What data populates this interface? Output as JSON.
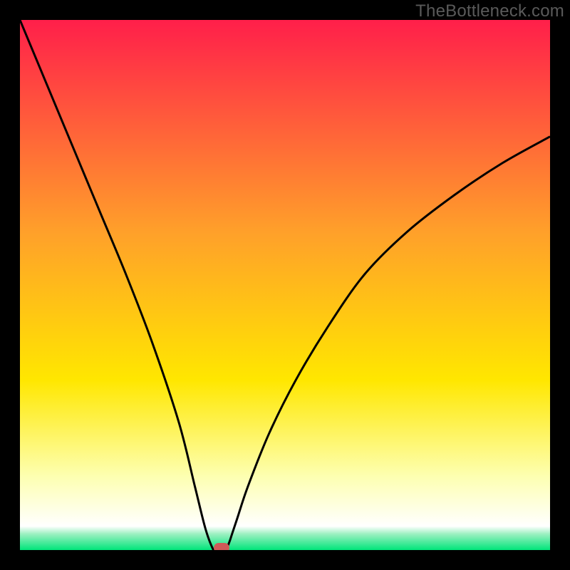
{
  "watermark": "TheBottleneck.com",
  "colors": {
    "frame": "#000000",
    "gradient_top": "#ff1f4a",
    "gradient_mid1": "#ffa02a",
    "gradient_mid2": "#ffe700",
    "gradient_mid3": "#fdffb0",
    "gradient_bottom": "#00e57a",
    "curve": "#000000",
    "marker": "#d05a58"
  },
  "chart_data": {
    "type": "line",
    "title": "",
    "xlabel": "",
    "ylabel": "",
    "xlim": [
      0,
      100
    ],
    "ylim": [
      0,
      100
    ],
    "series": [
      {
        "name": "bottleneck-curve",
        "x": [
          0,
          5,
          10,
          15,
          20,
          25,
          30,
          33,
          35,
          36.5,
          37,
          38,
          39,
          39.5,
          40,
          41,
          43,
          47,
          52,
          58,
          65,
          73,
          82,
          91,
          100
        ],
        "y": [
          100,
          88,
          76,
          64,
          52,
          39,
          24,
          12,
          4,
          0,
          0,
          0,
          0.5,
          1.5,
          3,
          6,
          12,
          22,
          32,
          42,
          52,
          60,
          67,
          73,
          78
        ]
      }
    ],
    "marker": {
      "x": 38,
      "y": 0,
      "color": "#d05a58"
    },
    "background_gradient_stops": [
      {
        "offset": 0.0,
        "color": "#ff1f4a"
      },
      {
        "offset": 0.4,
        "color": "#ffa02a"
      },
      {
        "offset": 0.68,
        "color": "#ffe700"
      },
      {
        "offset": 0.86,
        "color": "#fdffb0"
      },
      {
        "offset": 0.955,
        "color": "#ffffff"
      },
      {
        "offset": 0.97,
        "color": "#9af0c0"
      },
      {
        "offset": 1.0,
        "color": "#00e57a"
      }
    ]
  }
}
